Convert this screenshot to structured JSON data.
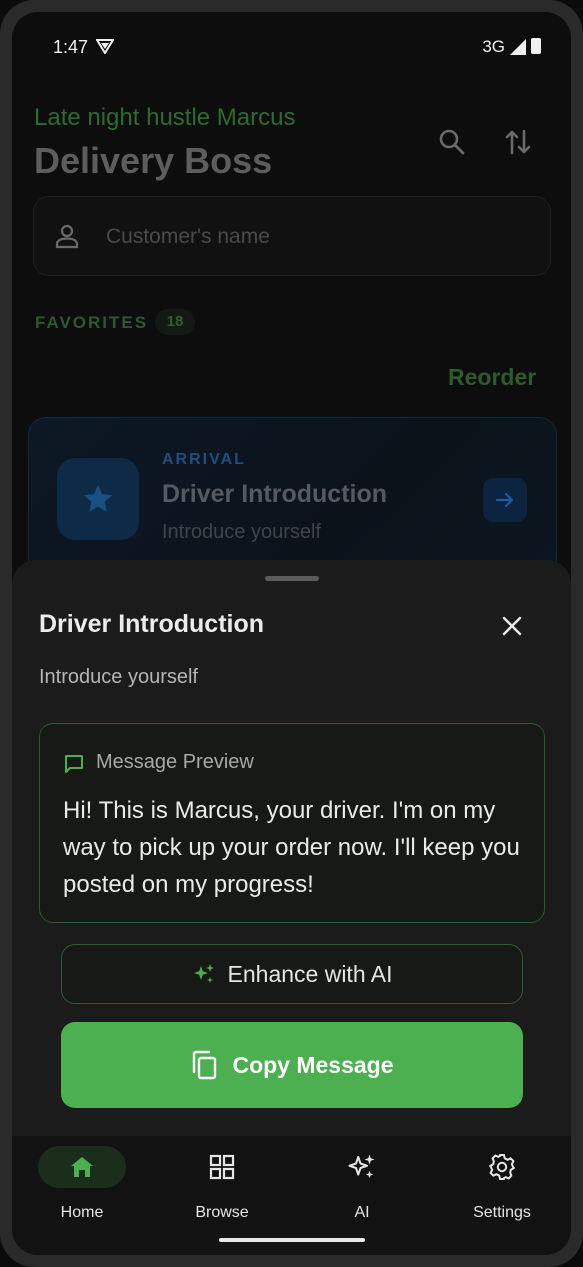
{
  "status": {
    "time": "1:47",
    "network": "3G"
  },
  "header": {
    "subtitle": "Late night hustle Marcus",
    "title": "Delivery Boss"
  },
  "search": {
    "placeholder": "Customer's name"
  },
  "favorites": {
    "label": "FAVORITES",
    "count": "18",
    "reorder": "Reorder"
  },
  "card": {
    "category": "ARRIVAL",
    "title": "Driver Introduction",
    "subtitle": "Introduce yourself"
  },
  "sheet": {
    "title": "Driver Introduction",
    "description": "Introduce yourself",
    "preview_heading": "Message Preview",
    "preview_text": "Hi! This is Marcus, your driver. I'm on my way to pick up your order now. I'll keep you posted on my progress!",
    "enhance_label": "Enhance with AI",
    "copy_label": "Copy Message"
  },
  "nav": [
    {
      "label": "Home",
      "icon": "home-icon",
      "active": true
    },
    {
      "label": "Browse",
      "icon": "grid-icon",
      "active": false
    },
    {
      "label": "AI",
      "icon": "sparkle-icon",
      "active": false
    },
    {
      "label": "Settings",
      "icon": "gear-icon",
      "active": false
    }
  ],
  "colors": {
    "accent": "#4caf50",
    "blue": "#1e4f80",
    "sheet": "#1b1b1b"
  }
}
